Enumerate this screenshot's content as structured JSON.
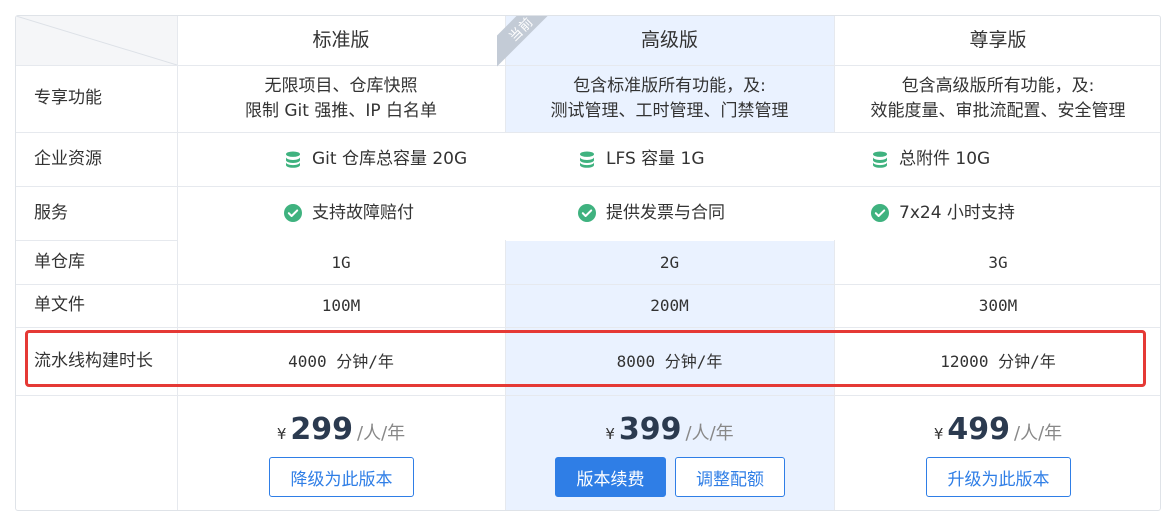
{
  "plans": [
    {
      "name": "标准版"
    },
    {
      "name": "高级版"
    },
    {
      "name": "尊享版"
    }
  ],
  "current_badge": "当前",
  "rows": {
    "exclusive": {
      "label": "专享功能",
      "cells": [
        {
          "line1": "无限项目、仓库快照",
          "line2": "限制 Git 强推、IP 白名单"
        },
        {
          "line1": "包含标准版所有功能，及:",
          "line2": "测试管理、工时管理、门禁管理"
        },
        {
          "line1": "包含高级版所有功能，及:",
          "line2": "效能度量、审批流配置、安全管理"
        }
      ]
    },
    "resources": {
      "label": "企业资源",
      "icon": "database-icon",
      "items": [
        "Git 仓库总容量 20G",
        "LFS 容量 1G",
        "总附件 10G"
      ]
    },
    "service": {
      "label": "服务",
      "icon": "check-circle-icon",
      "items": [
        "支持故障赔付",
        "提供发票与合同",
        "7x24 小时支持"
      ]
    },
    "single_repo": {
      "label": "单仓库",
      "values": [
        "1G",
        "2G",
        "3G"
      ]
    },
    "single_file": {
      "label": "单文件",
      "values": [
        "100M",
        "200M",
        "300M"
      ]
    },
    "pipeline": {
      "label": "流水线构建时长",
      "values": [
        "4000 分钟/年",
        "8000 分钟/年",
        "12000 分钟/年"
      ]
    }
  },
  "pricing": {
    "currency": "¥",
    "per": "/人/年",
    "prices": [
      "299",
      "399",
      "499"
    ],
    "buttons": {
      "downgrade": "降级为此版本",
      "renew": "版本续费",
      "adjust": "调整配额",
      "upgrade": "升级为此版本"
    }
  },
  "colors": {
    "accent": "#2f7ee6",
    "highlight_bg": "#eaf2ff",
    "icon_green": "#3fb27f",
    "annotation_red": "#e53935"
  }
}
